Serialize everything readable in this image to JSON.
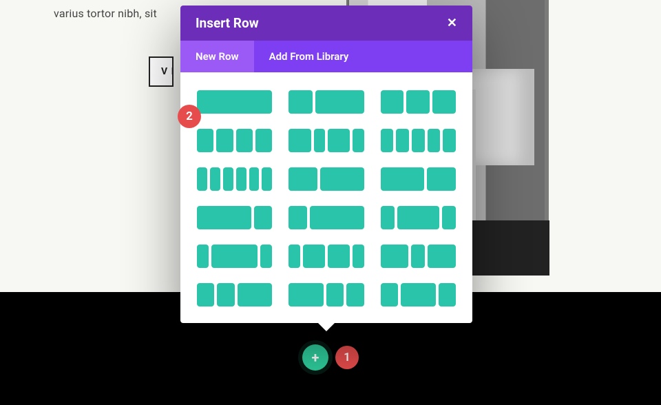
{
  "page": {
    "lorem_fragment": "varius tortor nibh, sit",
    "button_label_fragment": "V I"
  },
  "steps": {
    "one": "1",
    "two": "2"
  },
  "add_section": {
    "plus": "+"
  },
  "modal": {
    "title": "Insert Row",
    "close": "✕",
    "tabs": {
      "new_row": "New Row",
      "add_from_library": "Add From Library"
    },
    "layouts": [
      [
        1
      ],
      [
        1,
        2
      ],
      [
        1,
        1,
        1
      ],
      [
        1,
        1,
        1,
        1
      ],
      [
        2,
        1,
        2,
        1
      ],
      [
        1,
        1,
        1,
        1,
        1
      ],
      [
        1,
        1,
        1,
        1,
        1,
        1
      ],
      [
        2,
        3
      ],
      [
        3,
        2
      ],
      [
        3,
        1
      ],
      [
        1,
        3
      ],
      [
        1,
        3,
        1
      ],
      [
        1,
        4,
        1
      ],
      [
        1,
        2,
        2,
        1
      ],
      [
        2,
        1,
        2
      ],
      [
        1,
        1,
        2
      ],
      [
        2,
        1,
        1
      ],
      [
        1,
        2,
        1
      ]
    ]
  }
}
